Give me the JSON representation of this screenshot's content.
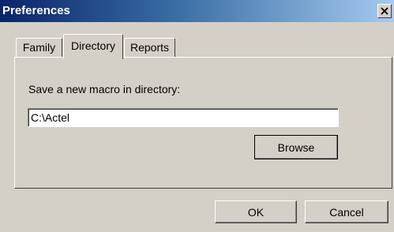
{
  "window": {
    "title": "Preferences",
    "close_glyph": "✕"
  },
  "tabs": [
    {
      "label": "Family",
      "selected": false
    },
    {
      "label": "Directory",
      "selected": true
    },
    {
      "label": "Reports",
      "selected": false
    }
  ],
  "directory_tab": {
    "label": "Save a new macro in directory:",
    "directory_value": "C:\\Actel",
    "browse_label": "Browse"
  },
  "footer": {
    "ok_label": "OK",
    "cancel_label": "Cancel"
  },
  "icons": {
    "close": "close-icon"
  }
}
